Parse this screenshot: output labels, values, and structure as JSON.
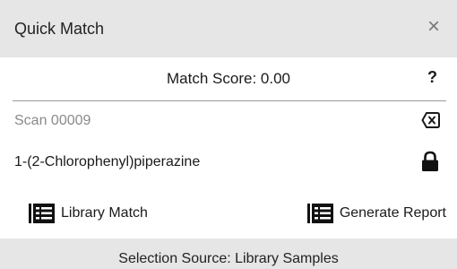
{
  "window": {
    "title": "Quick Match",
    "close_glyph": "×",
    "close_icon": "close-icon"
  },
  "score": {
    "label": "Match Score: 0.00",
    "help_glyph": "?",
    "help_icon": "help-icon"
  },
  "scan": {
    "name": "Scan 00009",
    "clear_icon": "clear-x-icon"
  },
  "compound": {
    "name": "1-(2-Chlorophenyl)piperazine",
    "lock_icon": "lock-icon"
  },
  "actions": {
    "library_match": {
      "label": "Library Match",
      "icon": "report-list-icon"
    },
    "generate_report": {
      "label": "Generate Report",
      "icon": "report-list-icon"
    }
  },
  "footer": {
    "text": "Selection Source: Library Samples"
  },
  "colors": {
    "header_bg": "#e6e6e6",
    "divider": "#9a9a9a",
    "muted_text": "#8a8a8a",
    "text": "#1a1a1a"
  }
}
